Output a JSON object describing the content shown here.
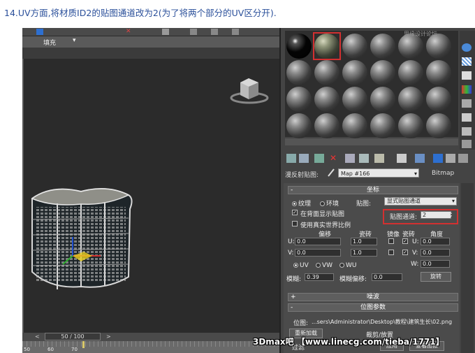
{
  "caption": "14.UV方面,将材质ID2的贴图通道改为2(为了将两个部分的UV区分开).",
  "viewport": {
    "toolbar_tab_label": "填充",
    "time_slider": "50 / 100",
    "track_numbers": [
      "50",
      "60",
      "70"
    ]
  },
  "material_editor": {
    "slot_count": 24,
    "selected_slot": 2,
    "map_label": "漫反射贴图:",
    "map_name": "Map #166",
    "map_type": "Bitmap",
    "coords_rollout": "坐标",
    "texture_label": "纹理",
    "environ_label": "环境",
    "mapping_label": "贴图:",
    "mapping_value": "显式贴图通道",
    "show_map_label": "在背面显示贴图",
    "channel_label": "贴图通道:",
    "channel_value": "2",
    "real_world_label": "使用真实世界比例",
    "col_offset": "偏移",
    "col_tiling": "瓷砖",
    "col_mirror": "镜像",
    "col_tile": "瓷砖",
    "col_angle": "角度",
    "u_label": "U:",
    "v_label": "V:",
    "w_label": "W:",
    "u_offset": "0.0",
    "v_offset": "0.0",
    "u_tiling": "1.0",
    "v_tiling": "1.0",
    "u_angle": "0.0",
    "v_angle": "0.0",
    "w_angle": "0.0",
    "uv_label": "UV",
    "vw_label": "VW",
    "wu_label": "WU",
    "blur_label": "模糊:",
    "blur_value": "0.39",
    "blur_offset_label": "模糊偏移:",
    "blur_offset_value": "0.0",
    "rotate_button": "旋转",
    "noise_rollout": "噪波",
    "bitmap_params_rollout": "位图参数",
    "bitmap_label": "位图:",
    "bitmap_path": "...sers\\Administrator\\Desktop\\教程\\建筑生长\\02.png",
    "reload_button": "重新加载",
    "crop_label": "裁剪/放置",
    "filter_label": "过滤",
    "apply_button": "应用",
    "view_image_button": "查看图像"
  },
  "watermark": "3Dmax吧 【www.linecg.com/tieba/1771】",
  "watermark_top": "思缘设计论坛"
}
